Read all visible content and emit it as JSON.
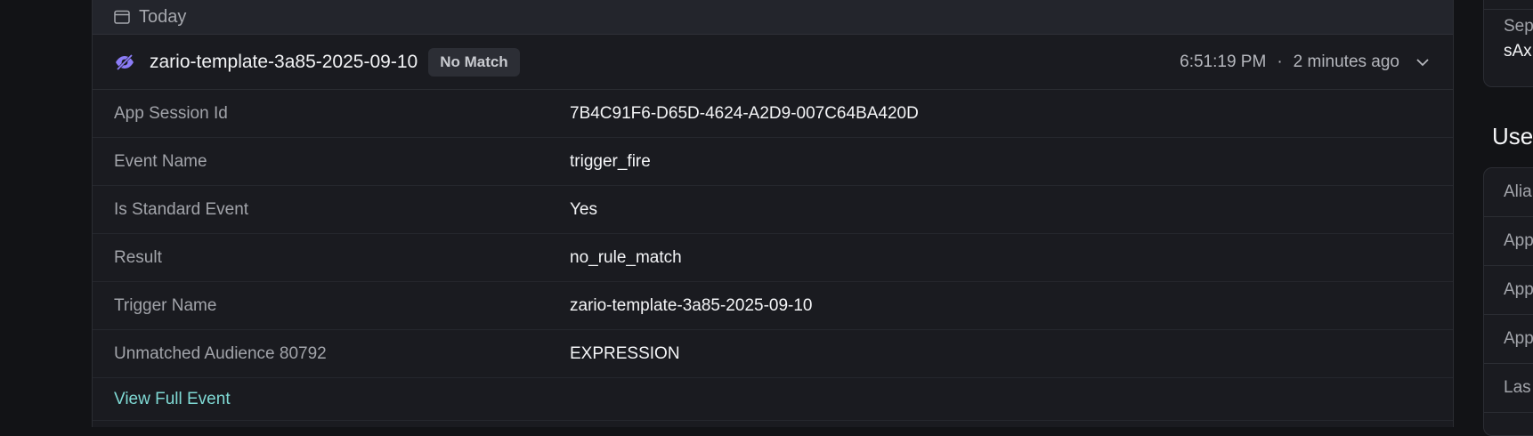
{
  "day": {
    "label": "Today"
  },
  "event": {
    "title": "zario-template-3a85-2025-09-10",
    "badge": "No Match",
    "time": "6:51:19 PM",
    "separator": "·",
    "relative": "2 minutes ago"
  },
  "rows": [
    {
      "label": "App Session Id",
      "value": "7B4C91F6-D65D-4624-A2D9-007C64BA420D"
    },
    {
      "label": "Event Name",
      "value": "trigger_fire"
    },
    {
      "label": "Is Standard Event",
      "value": "Yes"
    },
    {
      "label": "Result",
      "value": "no_rule_match"
    },
    {
      "label": "Trigger Name",
      "value": "zario-template-3a85-2025-09-10"
    },
    {
      "label": "Unmatched Audience 80792",
      "value": "EXPRESSION"
    }
  ],
  "link": {
    "label": "View Full Event"
  },
  "right_panel": {
    "card_label": "Sep",
    "card_value": "sAx",
    "section_title": "Use",
    "items": [
      "Alia",
      "App",
      "App",
      "App",
      "Las"
    ]
  },
  "colors": {
    "accent_link": "#7fd9d4",
    "icon_purple": "#8b7cf6",
    "background": "#121316",
    "card": "#1a1b20"
  },
  "icons": {
    "calendar": "calendar-icon",
    "hidden": "eye-off-icon",
    "expand": "chevron-down-icon"
  }
}
